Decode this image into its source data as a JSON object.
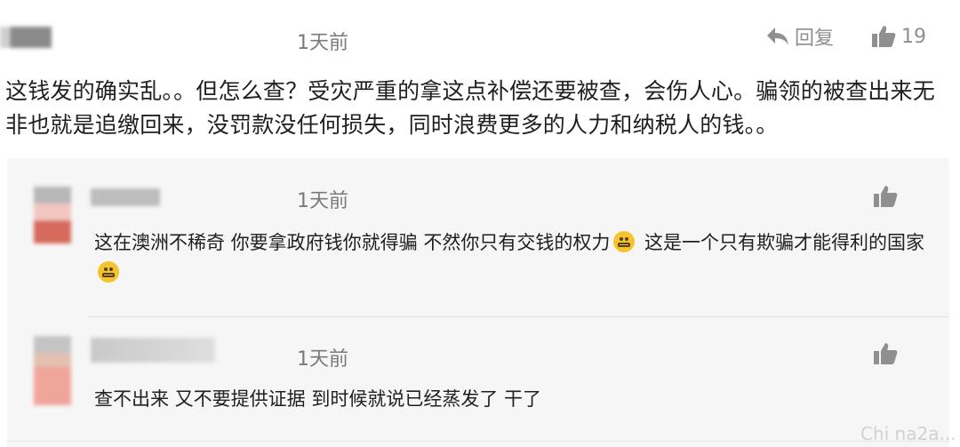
{
  "top_comment": {
    "time": "1天前",
    "reply_label": "回复",
    "likes": "19",
    "text": "这钱发的确实乱。。但怎么查？受灾严重的拿这点补偿还要被查，会伤人心。骗领的被查出来无非也就是追缴回来，没罚款没任何损失，同时浪费更多的人力和纳税人的钱。。",
    "icons": {
      "reply": "reply-arrow-icon",
      "like": "thumbs-up-icon"
    }
  },
  "replies": [
    {
      "time": "1天前",
      "text_1": "这在澳洲不稀奇 你要拿政府钱你就得骗 不然你只有交钱的权力",
      "text_2": " 这是一个只有欺骗才能得利的国家",
      "emoji": "zipper-mouth-face-icon"
    },
    {
      "time": "1天前",
      "text": "查不出来 又不要提供证据 到时候就说已经蒸发了 干了"
    }
  ],
  "watermark": "Chi na2a..."
}
